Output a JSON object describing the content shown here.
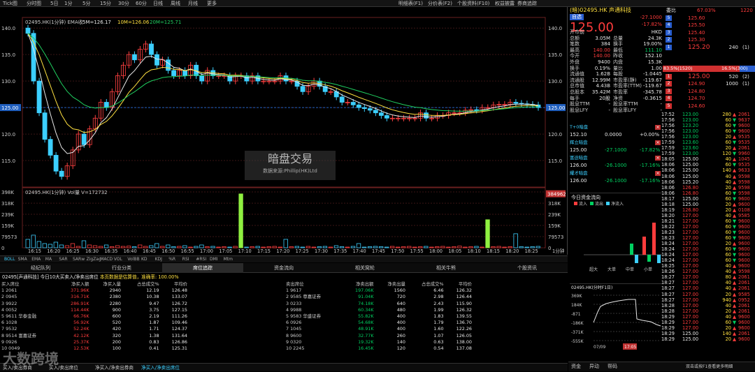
{
  "topbar": {
    "items": [
      "Tick图",
      "分时图",
      "5日",
      "1分",
      "5分",
      "15分",
      "30分",
      "60分",
      "日线",
      "周线",
      "月线",
      "更多",
      "复权",
      "指标",
      "模板",
      "阶段",
      "多股",
      "专家",
      "复盘"
    ],
    "right": [
      "明细表(F1)",
      "分价表(F2)",
      "个股资料(F10)",
      "权益披露",
      "券商追踪"
    ]
  },
  "chart": {
    "title": "02495.HK(1分钟) EMA收",
    "ma5": "5M=126.17",
    "ma10": "10M=126.06",
    "ma20": "20M=125.71",
    "price_ticks": [
      "140.0",
      "135.0",
      "130.0",
      "125.00",
      "120.0",
      "115.0"
    ],
    "last_price_label": "125.00",
    "vol_title": "02495.HK(1分钟) Vol量 V=172732",
    "vol_ticks": [
      "398K",
      "318K",
      "239K",
      "159K",
      "79573",
      "0"
    ],
    "vol_marker": "384962",
    "time_ticks": [
      "16:15",
      "16:20",
      "16:25",
      "16:30",
      "16:35",
      "16:40",
      "16:45",
      "16:50",
      "16:55",
      "17:00",
      "17:05",
      "17:10",
      "17:15",
      "17:20",
      "17:25",
      "17:30",
      "17:35",
      "17:40",
      "17:45",
      "17:50",
      "17:55",
      "18:00",
      "18:05",
      "18:10",
      "18:15",
      "18:20",
      "18:25"
    ],
    "period": "1分钟",
    "watermark_title": "暗盘交易",
    "watermark_sub": "数据来源:Phillip(HK)Ltd"
  },
  "indicators": [
    "BOLL",
    "SMA",
    "EMA",
    "MA",
    "SAR",
    "SARw",
    "ZigZag",
    "MACD",
    "VOL",
    "VolBB",
    "KD",
    "KDJ",
    "%R",
    "RSI",
    "#RSI",
    "DMI",
    "Mtm"
  ],
  "subtabs": [
    "经纪队列",
    "行业分类",
    "席位追踪",
    "资金流向",
    "相关窝轮",
    "相关牛熊",
    "个股资讯"
  ],
  "info": {
    "prefix": "02495[声通科技] 今日10大买卖入/净卖出席位",
    "note": "本页数据是估算值，准确率: 100.00%"
  },
  "buy_table": {
    "headers": [
      "买入席位",
      "净买入额",
      "净买入量",
      "占总成交%",
      "平均价"
    ],
    "rows": [
      [
        "1",
        "2061",
        "",
        "371.96K",
        "2940",
        "12.19",
        "126.48"
      ],
      [
        "2",
        "0945",
        "",
        "316.71K",
        "2380",
        "10.38",
        "133.07"
      ],
      [
        "3",
        "9922",
        "",
        "286.91K",
        "2280",
        "9.47",
        "126.72"
      ],
      [
        "4",
        "0052",
        "",
        "114.44K",
        "900",
        "3.75",
        "127.15"
      ],
      [
        "5",
        "9611",
        "华泰金融",
        "66.76K",
        "600",
        "2.19",
        "111.26"
      ],
      [
        "6",
        "1028",
        "",
        "56.92K",
        "520",
        "1.87",
        "109.46"
      ],
      [
        "7",
        "9532",
        "",
        "52.24K",
        "420",
        "1.71",
        "124.37"
      ],
      [
        "8",
        "9514",
        "富嘉证券",
        "42.12K",
        "320",
        "1.38",
        "131.64"
      ],
      [
        "9",
        "0926",
        "",
        "25.37K",
        "200",
        "0.83",
        "126.86"
      ],
      [
        "10",
        "0049",
        "",
        "12.53K",
        "100",
        "0.41",
        "125.31"
      ]
    ]
  },
  "sell_table": {
    "headers": [
      "卖出席位",
      "净卖出额",
      "净卖出量",
      "占总成交%",
      "平均价"
    ],
    "rows": [
      [
        "1",
        "9617",
        "",
        "197.06K",
        "1560",
        "6.46",
        "126.32"
      ],
      [
        "2",
        "9585",
        "尊嘉证券",
        "91.04K",
        "720",
        "2.98",
        "126.44"
      ],
      [
        "3",
        "0233",
        "",
        "74.18K",
        "640",
        "2.43",
        "115.90"
      ],
      [
        "4",
        "9988",
        "",
        "60.34K",
        "480",
        "1.99",
        "126.32"
      ],
      [
        "5",
        "9583",
        "华盛证券",
        "55.82K",
        "400",
        "1.83",
        "139.55"
      ],
      [
        "6",
        "0926",
        "",
        "54.68K",
        "400",
        "1.79",
        "136.70"
      ],
      [
        "7",
        "1045",
        "",
        "48.91K",
        "400",
        "1.60",
        "122.26"
      ],
      [
        "8",
        "9600",
        "",
        "32.77K",
        "260",
        "1.07",
        "126.05"
      ],
      [
        "9",
        "0320",
        "",
        "19.32K",
        "140",
        "0.63",
        "138.00"
      ],
      [
        "10",
        "2245",
        "",
        "16.45K",
        "120",
        "0.54",
        "137.08"
      ]
    ]
  },
  "bottomtabs": [
    "买入/卖出券商",
    "买入/卖出席位",
    "净买入/净卖出券商",
    "净买入/净卖出席位"
  ],
  "quote": {
    "header": "(暗)02495.HK 声通科技",
    "auto": "自选",
    "price": "125.00",
    "change": "-27.1000",
    "change_pct": "-17.82%",
    "webi": "委比",
    "webi_val": "67.03%",
    "webi_num": "1220",
    "stats": [
      [
        "开市前",
        "",
        "",
        "HKD"
      ],
      [
        "总额",
        "3.05M",
        "总量",
        "24.3K"
      ],
      [
        "笔数",
        "384",
        "换手",
        "19.00%"
      ],
      [
        "最高",
        "140.00",
        "最低",
        "111.10"
      ],
      [
        "今开",
        "140.00",
        "昨收",
        "152.10"
      ],
      [
        "外盘",
        "9400",
        "内盘",
        "15.3K"
      ],
      [
        "换手",
        "0.19%",
        "量比",
        "1.00"
      ],
      [
        "流通值",
        "1.62B",
        "每股",
        "-1.0445"
      ],
      [
        "流通股",
        "12.99M",
        "市盈率(静)",
        "-119.67"
      ],
      [
        "总市值",
        "4.43B",
        "市盈率(TTM)",
        "-119.67"
      ],
      [
        "总股本",
        "35.42M",
        "市盈率",
        "-345.78"
      ],
      [
        "每手",
        "20股",
        "净资",
        "-0.3615"
      ],
      [
        "股息TTM",
        "-",
        "股息率TTM",
        "-"
      ],
      [
        "股息LFY",
        "-",
        "股息率LFY",
        "-"
      ]
    ],
    "asks": [
      [
        "5",
        "125.60",
        ""
      ],
      [
        "4",
        "125.50",
        ""
      ],
      [
        "3",
        "125.40",
        ""
      ],
      [
        "2",
        "125.30",
        ""
      ],
      [
        "1",
        "125.20",
        "240",
        "1"
      ]
    ],
    "bids": [
      [
        "1",
        "125.00",
        "520",
        "2"
      ],
      [
        "2",
        "124.90",
        "1000",
        "1"
      ],
      [
        "3",
        "124.80",
        ""
      ],
      [
        "4",
        "124.70",
        ""
      ],
      [
        "5",
        "124.60",
        ""
      ]
    ],
    "ratio_buy": "83.5%(1520)",
    "ratio_sell": "16.5%(300)",
    "dark": [
      [
        "T+0暗盘",
        "",
        "",
        ""
      ],
      [
        "152.10",
        "0.0000",
        "+0.00%"
      ],
      [
        "辉立暗盘",
        "",
        "",
        ""
      ],
      [
        "125.00",
        "-27.1000",
        "-17.82%"
      ],
      [
        "富途暗盘",
        "",
        "",
        ""
      ],
      [
        "126.00",
        "-26.1000",
        "-17.16%"
      ],
      [
        "耀才暗盘",
        "",
        "",
        ""
      ],
      [
        "126.00",
        "-26.1000",
        "-17.16%"
      ]
    ],
    "flow_title": "今日资金流向",
    "flow_legend": [
      "流入",
      "流出",
      "净流入"
    ],
    "flow_labels": [
      "超大",
      "大单",
      "中单",
      "小单"
    ],
    "mini_title": "02495.HK(分时F1日)",
    "mini_ticks": [
      "369K",
      "184K",
      "-871",
      "-186K",
      "-371K",
      "-555K"
    ],
    "mini_time": [
      "07/09",
      "17:05"
    ],
    "bottom": [
      "资金",
      "异动",
      "帮码"
    ],
    "footnote": "双击或按F1查看更多明细"
  },
  "ticks": [
    [
      "17:52",
      "123.00",
      "280",
      "2061"
    ],
    [
      "17:56",
      "123.00",
      "60",
      "9637"
    ],
    [
      "17:56",
      "123.20",
      "60",
      "9600"
    ],
    [
      "17:56",
      "123.00",
      "60",
      "9600"
    ],
    [
      "17:56",
      "123.00",
      "20",
      "9535"
    ],
    [
      "17:59",
      "123.60",
      "60",
      "9535"
    ],
    [
      "17:59",
      "123.60",
      "20",
      "2061"
    ],
    [
      "17:59",
      "123.00",
      "120",
      "9960"
    ],
    [
      "18:05",
      "125.00",
      "40",
      "1045"
    ],
    [
      "18:06",
      "125.00",
      "60",
      "9535"
    ],
    [
      "18:06",
      "125.00",
      "140",
      "9633"
    ],
    [
      "18:06",
      "125.00",
      "40",
      "9598"
    ],
    [
      "18:06",
      "125.20",
      "40",
      "9598"
    ],
    [
      "18:06",
      "126.80",
      "20",
      "9598"
    ],
    [
      "18:06",
      "126.80",
      "60",
      "9598"
    ],
    [
      "18:17",
      "125.00",
      "60",
      "9600"
    ],
    [
      "18:18",
      "125.00",
      "20",
      "9600"
    ],
    [
      "18:19",
      "126.80",
      "20",
      "0108"
    ],
    [
      "18:20",
      "127.00",
      "40",
      "9585"
    ],
    [
      "18:21",
      "127.00",
      "60",
      "9600"
    ],
    [
      "18:22",
      "127.00",
      "60",
      "9600"
    ],
    [
      "18:23",
      "127.00",
      "60",
      "9600"
    ],
    [
      "18:23",
      "127.00",
      "60",
      "9600"
    ],
    [
      "18:24",
      "127.00",
      "20",
      "9600"
    ],
    [
      "18:24",
      "127.00",
      "60",
      "9600"
    ],
    [
      "18:24",
      "127.00",
      "60",
      "9600"
    ],
    [
      "18:24",
      "127.00",
      "60",
      "9600"
    ],
    [
      "18:25",
      "127.00",
      "40",
      "9600"
    ],
    [
      "18:26",
      "127.00",
      "40",
      "9598"
    ],
    [
      "18:27",
      "127.00",
      "80",
      "2061"
    ],
    [
      "18:27",
      "127.00",
      "40",
      "2061"
    ],
    [
      "18:27",
      "127.00",
      "40",
      "2061"
    ],
    [
      "18:27",
      "127.00",
      "20",
      "9585"
    ],
    [
      "18:27",
      "127.00",
      "940",
      "0952"
    ],
    [
      "18:28",
      "127.00",
      "40",
      "2061"
    ],
    [
      "18:28",
      "127.00",
      "20",
      "2061"
    ],
    [
      "18:29",
      "127.00",
      "40",
      "9600"
    ],
    [
      "18:29",
      "127.00",
      "60",
      "9600"
    ],
    [
      "18:29",
      "127.00",
      "20",
      "9600"
    ],
    [
      "18:29",
      "125.00",
      "140",
      "2061"
    ],
    [
      "18:29",
      "125.00",
      "20",
      "9600"
    ]
  ],
  "watermark": "大数跨境"
}
